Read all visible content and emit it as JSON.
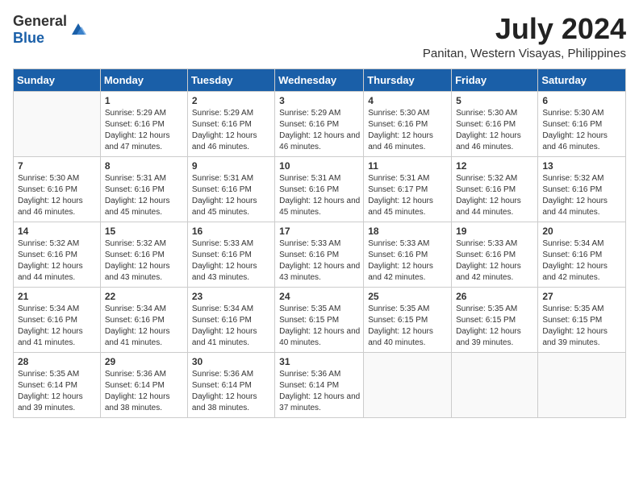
{
  "app": {
    "name_general": "General",
    "name_blue": "Blue"
  },
  "header": {
    "month_year": "July 2024",
    "location": "Panitan, Western Visayas, Philippines"
  },
  "weekdays": [
    "Sunday",
    "Monday",
    "Tuesday",
    "Wednesday",
    "Thursday",
    "Friday",
    "Saturday"
  ],
  "weeks": [
    [
      {
        "day": "",
        "sunrise": "",
        "sunset": "",
        "daylight": ""
      },
      {
        "day": "1",
        "sunrise": "Sunrise: 5:29 AM",
        "sunset": "Sunset: 6:16 PM",
        "daylight": "Daylight: 12 hours and 47 minutes."
      },
      {
        "day": "2",
        "sunrise": "Sunrise: 5:29 AM",
        "sunset": "Sunset: 6:16 PM",
        "daylight": "Daylight: 12 hours and 46 minutes."
      },
      {
        "day": "3",
        "sunrise": "Sunrise: 5:29 AM",
        "sunset": "Sunset: 6:16 PM",
        "daylight": "Daylight: 12 hours and 46 minutes."
      },
      {
        "day": "4",
        "sunrise": "Sunrise: 5:30 AM",
        "sunset": "Sunset: 6:16 PM",
        "daylight": "Daylight: 12 hours and 46 minutes."
      },
      {
        "day": "5",
        "sunrise": "Sunrise: 5:30 AM",
        "sunset": "Sunset: 6:16 PM",
        "daylight": "Daylight: 12 hours and 46 minutes."
      },
      {
        "day": "6",
        "sunrise": "Sunrise: 5:30 AM",
        "sunset": "Sunset: 6:16 PM",
        "daylight": "Daylight: 12 hours and 46 minutes."
      }
    ],
    [
      {
        "day": "7",
        "sunrise": "Sunrise: 5:30 AM",
        "sunset": "Sunset: 6:16 PM",
        "daylight": "Daylight: 12 hours and 46 minutes."
      },
      {
        "day": "8",
        "sunrise": "Sunrise: 5:31 AM",
        "sunset": "Sunset: 6:16 PM",
        "daylight": "Daylight: 12 hours and 45 minutes."
      },
      {
        "day": "9",
        "sunrise": "Sunrise: 5:31 AM",
        "sunset": "Sunset: 6:16 PM",
        "daylight": "Daylight: 12 hours and 45 minutes."
      },
      {
        "day": "10",
        "sunrise": "Sunrise: 5:31 AM",
        "sunset": "Sunset: 6:16 PM",
        "daylight": "Daylight: 12 hours and 45 minutes."
      },
      {
        "day": "11",
        "sunrise": "Sunrise: 5:31 AM",
        "sunset": "Sunset: 6:17 PM",
        "daylight": "Daylight: 12 hours and 45 minutes."
      },
      {
        "day": "12",
        "sunrise": "Sunrise: 5:32 AM",
        "sunset": "Sunset: 6:16 PM",
        "daylight": "Daylight: 12 hours and 44 minutes."
      },
      {
        "day": "13",
        "sunrise": "Sunrise: 5:32 AM",
        "sunset": "Sunset: 6:16 PM",
        "daylight": "Daylight: 12 hours and 44 minutes."
      }
    ],
    [
      {
        "day": "14",
        "sunrise": "Sunrise: 5:32 AM",
        "sunset": "Sunset: 6:16 PM",
        "daylight": "Daylight: 12 hours and 44 minutes."
      },
      {
        "day": "15",
        "sunrise": "Sunrise: 5:32 AM",
        "sunset": "Sunset: 6:16 PM",
        "daylight": "Daylight: 12 hours and 43 minutes."
      },
      {
        "day": "16",
        "sunrise": "Sunrise: 5:33 AM",
        "sunset": "Sunset: 6:16 PM",
        "daylight": "Daylight: 12 hours and 43 minutes."
      },
      {
        "day": "17",
        "sunrise": "Sunrise: 5:33 AM",
        "sunset": "Sunset: 6:16 PM",
        "daylight": "Daylight: 12 hours and 43 minutes."
      },
      {
        "day": "18",
        "sunrise": "Sunrise: 5:33 AM",
        "sunset": "Sunset: 6:16 PM",
        "daylight": "Daylight: 12 hours and 42 minutes."
      },
      {
        "day": "19",
        "sunrise": "Sunrise: 5:33 AM",
        "sunset": "Sunset: 6:16 PM",
        "daylight": "Daylight: 12 hours and 42 minutes."
      },
      {
        "day": "20",
        "sunrise": "Sunrise: 5:34 AM",
        "sunset": "Sunset: 6:16 PM",
        "daylight": "Daylight: 12 hours and 42 minutes."
      }
    ],
    [
      {
        "day": "21",
        "sunrise": "Sunrise: 5:34 AM",
        "sunset": "Sunset: 6:16 PM",
        "daylight": "Daylight: 12 hours and 41 minutes."
      },
      {
        "day": "22",
        "sunrise": "Sunrise: 5:34 AM",
        "sunset": "Sunset: 6:16 PM",
        "daylight": "Daylight: 12 hours and 41 minutes."
      },
      {
        "day": "23",
        "sunrise": "Sunrise: 5:34 AM",
        "sunset": "Sunset: 6:16 PM",
        "daylight": "Daylight: 12 hours and 41 minutes."
      },
      {
        "day": "24",
        "sunrise": "Sunrise: 5:35 AM",
        "sunset": "Sunset: 6:15 PM",
        "daylight": "Daylight: 12 hours and 40 minutes."
      },
      {
        "day": "25",
        "sunrise": "Sunrise: 5:35 AM",
        "sunset": "Sunset: 6:15 PM",
        "daylight": "Daylight: 12 hours and 40 minutes."
      },
      {
        "day": "26",
        "sunrise": "Sunrise: 5:35 AM",
        "sunset": "Sunset: 6:15 PM",
        "daylight": "Daylight: 12 hours and 39 minutes."
      },
      {
        "day": "27",
        "sunrise": "Sunrise: 5:35 AM",
        "sunset": "Sunset: 6:15 PM",
        "daylight": "Daylight: 12 hours and 39 minutes."
      }
    ],
    [
      {
        "day": "28",
        "sunrise": "Sunrise: 5:35 AM",
        "sunset": "Sunset: 6:14 PM",
        "daylight": "Daylight: 12 hours and 39 minutes."
      },
      {
        "day": "29",
        "sunrise": "Sunrise: 5:36 AM",
        "sunset": "Sunset: 6:14 PM",
        "daylight": "Daylight: 12 hours and 38 minutes."
      },
      {
        "day": "30",
        "sunrise": "Sunrise: 5:36 AM",
        "sunset": "Sunset: 6:14 PM",
        "daylight": "Daylight: 12 hours and 38 minutes."
      },
      {
        "day": "31",
        "sunrise": "Sunrise: 5:36 AM",
        "sunset": "Sunset: 6:14 PM",
        "daylight": "Daylight: 12 hours and 37 minutes."
      },
      {
        "day": "",
        "sunrise": "",
        "sunset": "",
        "daylight": ""
      },
      {
        "day": "",
        "sunrise": "",
        "sunset": "",
        "daylight": ""
      },
      {
        "day": "",
        "sunrise": "",
        "sunset": "",
        "daylight": ""
      }
    ]
  ]
}
